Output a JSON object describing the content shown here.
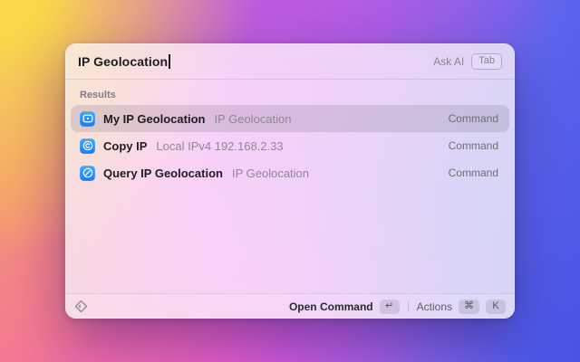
{
  "window": {
    "search": {
      "value": "IP Geolocation",
      "ai_hint": "Ask AI",
      "ai_key": "Tab"
    },
    "results": {
      "section_label": "Results",
      "items": [
        {
          "title": "My IP Geolocation",
          "subtitle": "IP Geolocation",
          "accessory": "Command",
          "icon": "screen-location-icon",
          "selected": true
        },
        {
          "title": "Copy IP",
          "subtitle": "Local IPv4 192.168.2.33",
          "accessory": "Command",
          "icon": "circled-c-icon",
          "selected": false
        },
        {
          "title": "Query IP Geolocation",
          "subtitle": "IP Geolocation",
          "accessory": "Command",
          "icon": "compass-icon",
          "selected": false
        }
      ]
    },
    "footer": {
      "primary_action": "Open Command",
      "primary_key": "↵",
      "secondary_action": "Actions",
      "secondary_key_1": "⌘",
      "secondary_key_2": "K"
    }
  },
  "colors": {
    "icon_tile_blue": "#2391fa",
    "selection_highlight": "rgba(125,112,128,0.22)",
    "accent_text": "#1e1e20"
  }
}
